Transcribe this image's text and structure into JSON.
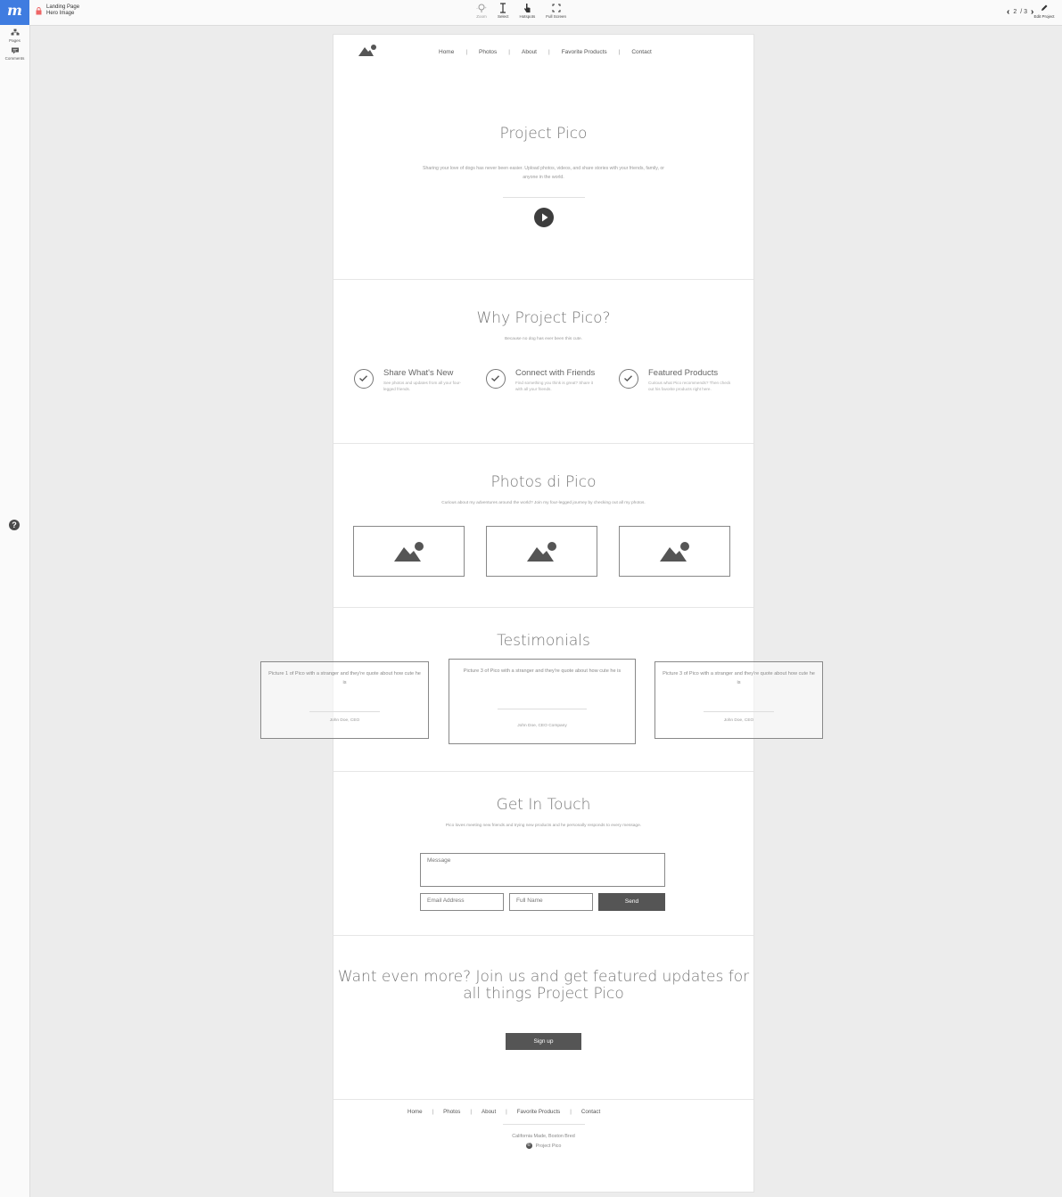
{
  "app": {
    "logo_text": "m",
    "crumbs": {
      "line1": "Landing Page",
      "line2": "Hero Image"
    },
    "toolbar": [
      {
        "name": "zoom",
        "label": "Zoom",
        "icon": "zoom-icon",
        "dim": true
      },
      {
        "name": "select",
        "label": "Select",
        "icon": "text-cursor-icon",
        "dim": false
      },
      {
        "name": "hotspots",
        "label": "Hotspots",
        "icon": "hand-pointer-icon",
        "dim": false
      },
      {
        "name": "fullscreen",
        "label": "Full Screen",
        "icon": "fullscreen-icon",
        "dim": false
      }
    ],
    "pager": {
      "current": "2",
      "total": "/ 3"
    },
    "edit_label": "Edit Project",
    "sidebar": {
      "pages_label": "Pages",
      "comments_label": "Comments"
    },
    "help_icon": "?"
  },
  "site": {
    "nav": [
      "Home",
      "Photos",
      "About",
      "Favorite Products",
      "Contact"
    ],
    "nav_separator": "|",
    "hero": {
      "title": "Project Pico",
      "text": "Sharing your love of dogs has never been easier. Upload photos, videos, and share stories with your friends, family, or anyone in the world."
    },
    "why": {
      "title": "Why Project Pico?",
      "subtitle": "Because no dog has ever been this cute.",
      "features": [
        {
          "title": "Share What's New",
          "desc": "See photos and updates from all your four-legged friends."
        },
        {
          "title": "Connect with Friends",
          "desc": "Find something you think is great? Share it with all your friends."
        },
        {
          "title": "Featured Products",
          "desc": "Curious what Pico recommends? Then check out his favorite products right here."
        }
      ]
    },
    "photos": {
      "title": "Photos di Pico",
      "subtitle": "Curious about my adventures around the world? Join my four-legged journey by checking out all my photos."
    },
    "testimonials": {
      "title": "Testimonials",
      "items": [
        {
          "quote": "Picture 1 of Pico with a stranger and they're quote about how cute he is",
          "author": "John Doe, CEO"
        },
        {
          "quote": "Picture 3 of Pico with a stranger and they're quote about how cute he is",
          "author": "John Doe, CEO Company"
        },
        {
          "quote": "Picture 3 of Pico with a stranger and they're quote about how cute he is",
          "author": "John Doe, CEO"
        }
      ]
    },
    "contact": {
      "title": "Get In Touch",
      "subtitle": "Pico loves meeting new friends and trying new products and he personally responds to every message.",
      "message_placeholder": "Message",
      "email_placeholder": "Email Address",
      "name_placeholder": "Full Name",
      "send_label": "Send"
    },
    "cta": {
      "title": "Want even more? Join us and get featured updates for all things Project Pico",
      "button_label": "Sign up"
    },
    "footer": {
      "links": [
        "Home",
        "Photos",
        "About",
        "Favorite Products",
        "Contact"
      ],
      "tagline": "California Made, Boston Bred",
      "copyright": "Project Pico",
      "copyright_symbol": "©"
    }
  }
}
